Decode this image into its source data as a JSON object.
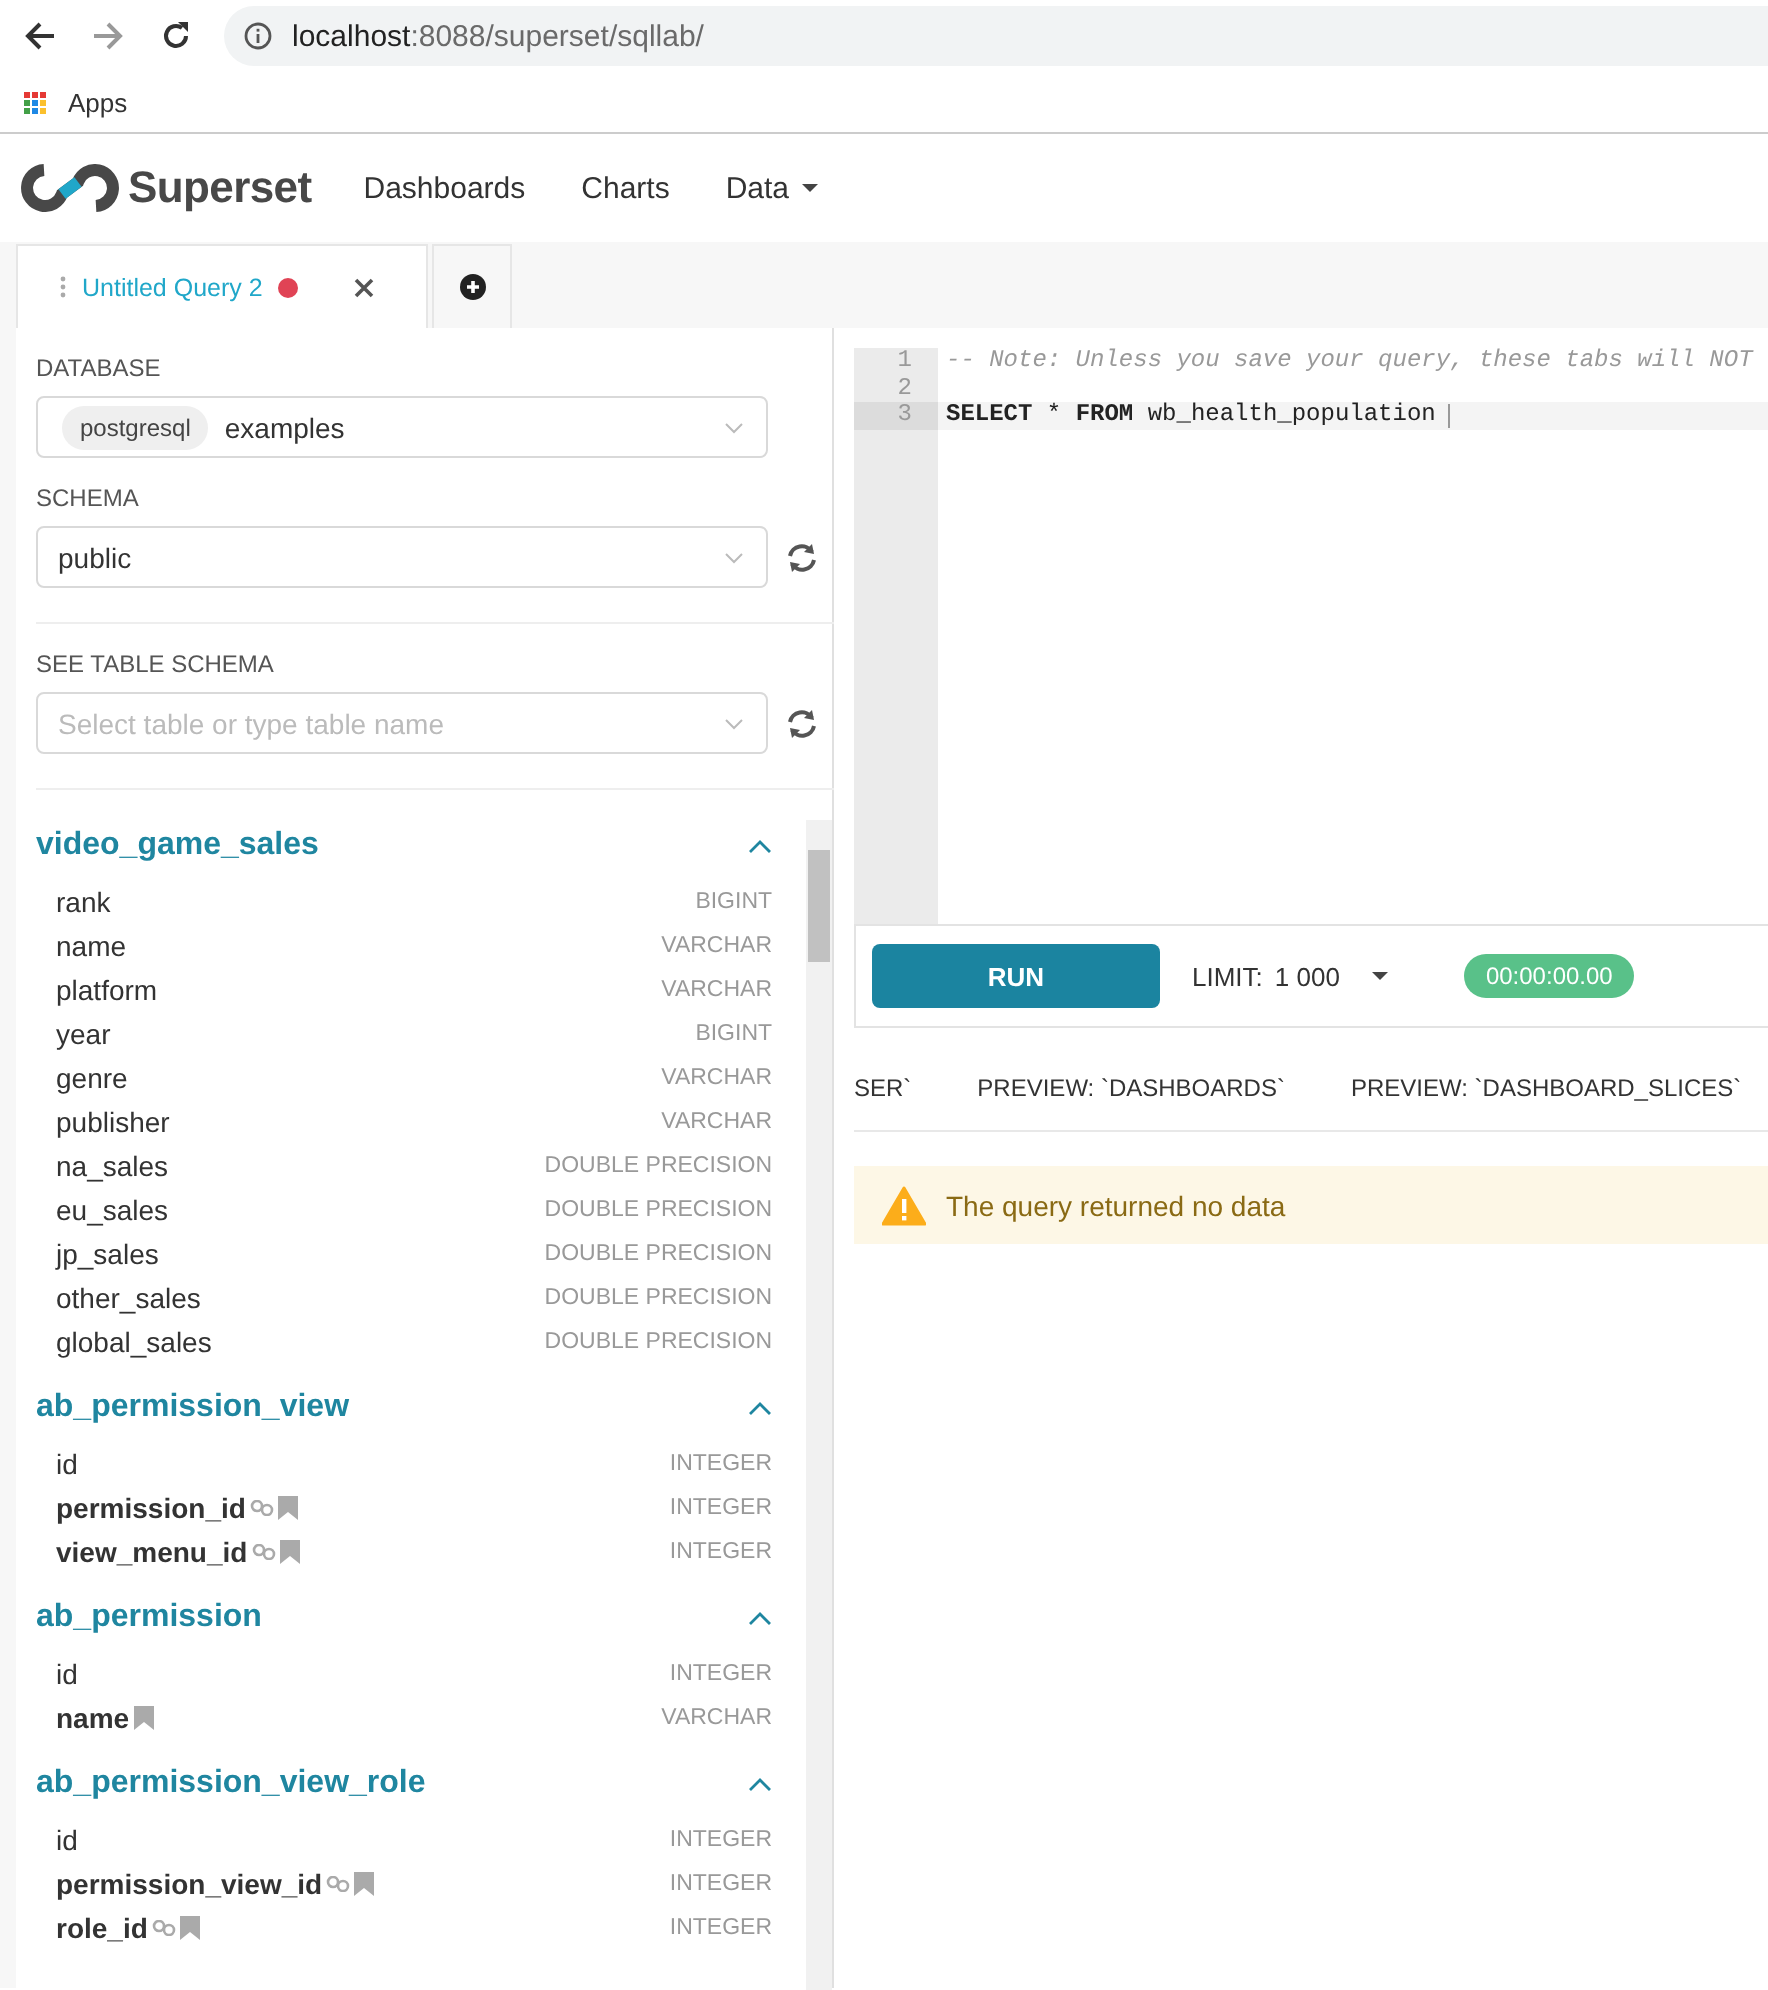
{
  "browser": {
    "address_bar": {
      "host": "localhost",
      "path": ":8088/superset/sqllab/"
    },
    "bookmarks": [
      "Apps"
    ]
  },
  "navbar": {
    "brand": "Superset",
    "items": [
      {
        "label": "Dashboards",
        "dropdown": false
      },
      {
        "label": "Charts",
        "dropdown": false
      },
      {
        "label": "Data",
        "dropdown": true
      }
    ]
  },
  "query_tabs": [
    {
      "title": "Untitled Query 2",
      "selected": true,
      "unsaved": true
    }
  ],
  "sidebar": {
    "database": {
      "label": "DATABASE",
      "tag": "postgresql",
      "value": "examples"
    },
    "schema": {
      "label": "SCHEMA",
      "value": "public"
    },
    "table_schema": {
      "label": "SEE TABLE SCHEMA",
      "placeholder": "Select table or type table name"
    },
    "tables": [
      {
        "name": "video_game_sales",
        "expanded": true,
        "columns": [
          {
            "name": "rank",
            "type": "BIGINT",
            "foreign_key": false,
            "indexed": false
          },
          {
            "name": "name",
            "type": "VARCHAR",
            "foreign_key": false,
            "indexed": false
          },
          {
            "name": "platform",
            "type": "VARCHAR",
            "foreign_key": false,
            "indexed": false
          },
          {
            "name": "year",
            "type": "BIGINT",
            "foreign_key": false,
            "indexed": false
          },
          {
            "name": "genre",
            "type": "VARCHAR",
            "foreign_key": false,
            "indexed": false
          },
          {
            "name": "publisher",
            "type": "VARCHAR",
            "foreign_key": false,
            "indexed": false
          },
          {
            "name": "na_sales",
            "type": "DOUBLE PRECISION",
            "foreign_key": false,
            "indexed": false
          },
          {
            "name": "eu_sales",
            "type": "DOUBLE PRECISION",
            "foreign_key": false,
            "indexed": false
          },
          {
            "name": "jp_sales",
            "type": "DOUBLE PRECISION",
            "foreign_key": false,
            "indexed": false
          },
          {
            "name": "other_sales",
            "type": "DOUBLE PRECISION",
            "foreign_key": false,
            "indexed": false
          },
          {
            "name": "global_sales",
            "type": "DOUBLE PRECISION",
            "foreign_key": false,
            "indexed": false
          }
        ]
      },
      {
        "name": "ab_permission_view",
        "expanded": true,
        "columns": [
          {
            "name": "id",
            "type": "INTEGER",
            "foreign_key": false,
            "indexed": false
          },
          {
            "name": "permission_id",
            "type": "INTEGER",
            "foreign_key": true,
            "indexed": true
          },
          {
            "name": "view_menu_id",
            "type": "INTEGER",
            "foreign_key": true,
            "indexed": true
          }
        ]
      },
      {
        "name": "ab_permission",
        "expanded": true,
        "columns": [
          {
            "name": "id",
            "type": "INTEGER",
            "foreign_key": false,
            "indexed": false
          },
          {
            "name": "name",
            "type": "VARCHAR",
            "foreign_key": false,
            "indexed": true
          }
        ]
      },
      {
        "name": "ab_permission_view_role",
        "expanded": true,
        "columns": [
          {
            "name": "id",
            "type": "INTEGER",
            "foreign_key": false,
            "indexed": false
          },
          {
            "name": "permission_view_id",
            "type": "INTEGER",
            "foreign_key": true,
            "indexed": true
          },
          {
            "name": "role_id",
            "type": "INTEGER",
            "foreign_key": true,
            "indexed": true
          }
        ]
      }
    ]
  },
  "editor": {
    "lines": [
      {
        "number": "1",
        "kind": "comment",
        "text": "-- Note: Unless you save your query, these tabs will NOT",
        "active": false
      },
      {
        "number": "2",
        "active": false
      },
      {
        "number": "3",
        "kind": "code",
        "text": "**SELECT** * **FROM** wb_health_population",
        "active": true
      }
    ]
  },
  "run_bar": {
    "run": "RUN",
    "limit_label": "LIMIT:",
    "limit_value": "1 000",
    "timer": "00:00:00.00"
  },
  "result_tabs": [
    {
      "label": "SER`",
      "selected": false
    },
    {
      "label": "PREVIEW: `DASHBOARDS`",
      "selected": false
    },
    {
      "label": "PREVIEW: `DASHBOARD_SLICES`",
      "selected": false
    }
  ],
  "alert": {
    "kind": "warning",
    "text": "The query returned no data"
  }
}
